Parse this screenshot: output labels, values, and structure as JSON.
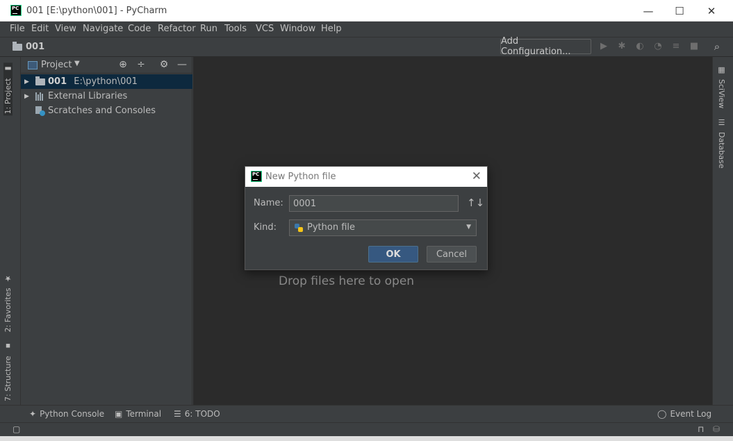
{
  "window": {
    "title": "001 [E:\\python\\001] - PyCharm",
    "logo_text": "PC",
    "minimize": "—",
    "maximize": "☐",
    "close": "✕"
  },
  "menu": [
    "File",
    "Edit",
    "View",
    "Navigate",
    "Code",
    "Refactor",
    "Run",
    "Tools",
    "VCS",
    "Window",
    "Help"
  ],
  "navbar": {
    "breadcrumb": "001",
    "add_configuration": "Add Configuration..."
  },
  "left_tabs": {
    "project": "1: Project",
    "favorites": "2: Favorites",
    "structure": "7: Structure"
  },
  "right_tabs": {
    "sciview": "SciView",
    "database": "Database"
  },
  "project_panel": {
    "title": "Project",
    "tree": [
      {
        "name": "001",
        "path": "E:\\python\\001"
      },
      {
        "name": "External Libraries"
      },
      {
        "name": "Scratches and Consoles"
      }
    ]
  },
  "editor": {
    "placeholder": "Drop files here to open"
  },
  "dialog": {
    "title": "New Python file",
    "logo_text": "PC",
    "name_label": "Name:",
    "name_value": "0001",
    "kind_label": "Kind:",
    "kind_value": "Python file",
    "ok": "OK",
    "cancel": "Cancel"
  },
  "bottom_tools": {
    "python_console": "Python Console",
    "terminal": "Terminal",
    "todo": "6: TODO",
    "event_log": "Event Log"
  },
  "colors": {
    "accent": "#365880",
    "selection": "#0d293e",
    "editor_bg": "#2b2b2b",
    "panel_bg": "#3c3f41"
  }
}
